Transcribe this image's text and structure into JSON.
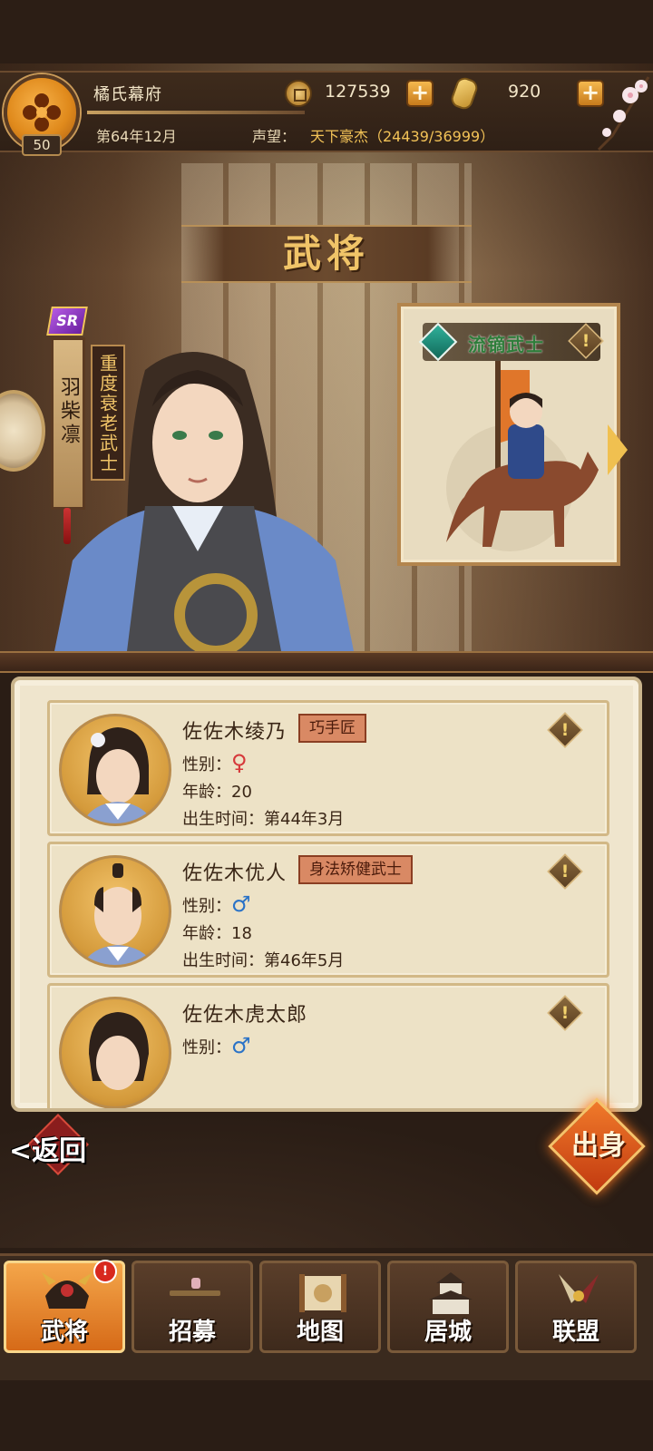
{
  "header": {
    "clan_name": "橘氏幕府",
    "level": "50",
    "date": "第64年12月",
    "prestige_label": "声望：",
    "prestige_value": "天下豪杰（24439/36999）",
    "coins": "127539",
    "gold": "920"
  },
  "page_title": "武将",
  "hero": {
    "rarity": "SR",
    "name": "羽柴凛",
    "trait": "重度衰老武士",
    "unit_name": "流镝武士"
  },
  "list": [
    {
      "name": "佐佐木绫乃",
      "tag": "巧手匠",
      "gender_label": "性别：",
      "gender": "♀",
      "age_label": "年龄：",
      "age": "20",
      "birth_label": "出生时间：",
      "birth": "第44年3月"
    },
    {
      "name": "佐佐木优人",
      "tag": "身法矫健武士",
      "gender_label": "性别：",
      "gender": "♂",
      "age_label": "年龄：",
      "age": "18",
      "birth_label": "出生时间：",
      "birth": "第46年5月"
    },
    {
      "name": "佐佐木虎太郎",
      "tag": "",
      "gender_label": "性别：",
      "gender": "♂"
    }
  ],
  "controls": {
    "back": "返回",
    "deploy": "出身"
  },
  "nav": [
    {
      "label": "武将",
      "badge": "!"
    },
    {
      "label": "招募"
    },
    {
      "label": "地图"
    },
    {
      "label": "居城"
    },
    {
      "label": "联盟"
    }
  ],
  "icons": {
    "info": "!",
    "plus": "+"
  }
}
